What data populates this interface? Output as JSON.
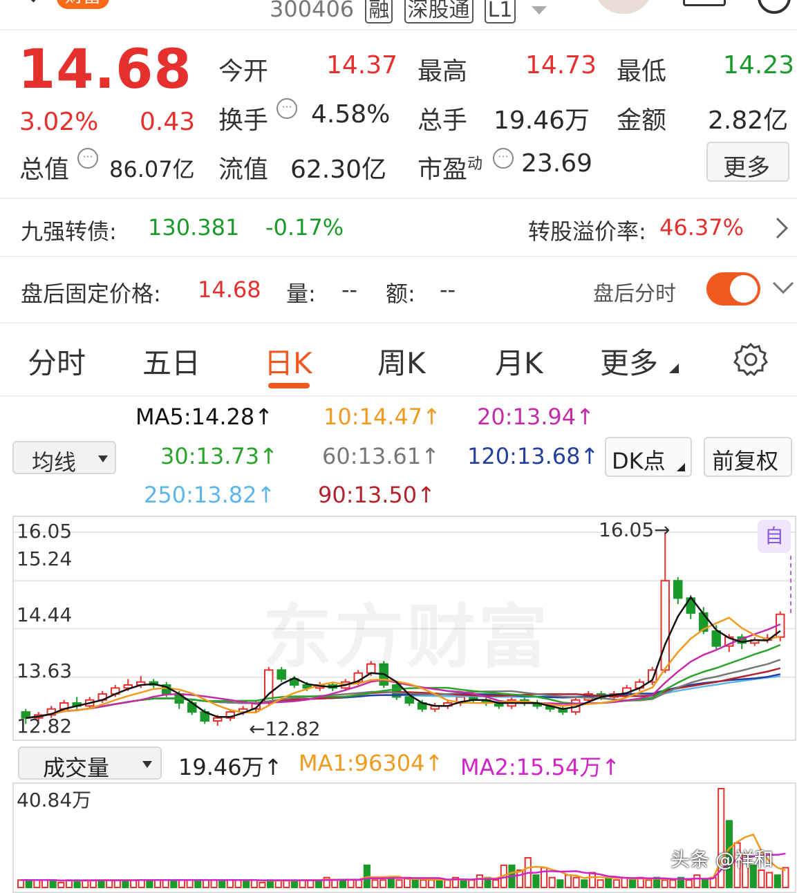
{
  "header": {
    "stock_code": "300406",
    "tags": [
      "融",
      "深股通",
      "L1"
    ],
    "badge": "财富"
  },
  "quote": {
    "price": "14.68",
    "change_pct": "3.02%",
    "change_amt": "0.43",
    "open_label": "今开",
    "open": "14.37",
    "high_label": "最高",
    "high": "14.73",
    "low_label": "最低",
    "low": "14.23",
    "turnover_label": "换手",
    "turnover": "4.58%",
    "volume_label": "总手",
    "volume": "19.46万",
    "amount_label": "金额",
    "amount": "2.82亿",
    "mktcap_label": "总值",
    "mktcap": "86.07亿",
    "float_label": "流值",
    "float": "62.30亿",
    "pe_label": "市盈",
    "pe_sup": "动",
    "pe": "23.69",
    "more_button": "更多"
  },
  "bond": {
    "label": "九强转债:",
    "price": "130.381",
    "change": "-0.17%",
    "premium_label": "转股溢价率:",
    "premium": "46.37%"
  },
  "afterhours": {
    "label": "盘后固定价格:",
    "price": "14.68",
    "vol_label": "量:",
    "vol": "--",
    "amt_label": "额:",
    "amt": "--",
    "toggle_label": "盘后分时",
    "toggle_on": true
  },
  "tabs": [
    "分时",
    "五日",
    "日K",
    "周K",
    "月K",
    "更多"
  ],
  "active_tab": 2,
  "ma": {
    "ma5": "MA5:14.28↑",
    "ma10": "10:14.47↑",
    "ma20": "20:13.94↑",
    "ma30": "30:13.73↑",
    "ma60": "60:13.61↑",
    "ma120": "120:13.68↑",
    "ma250": "250:13.82↑",
    "ma90": "90:13.50↑",
    "select_label": "均线",
    "dk_button": "DK点",
    "adjust_button": "前复权"
  },
  "chart_data": {
    "type": "candlestick",
    "y_ticks": [
      "16.05",
      "15.24",
      "14.44",
      "13.63",
      "12.82"
    ],
    "ylim": [
      12.82,
      16.05
    ],
    "max_label": "16.05→",
    "min_label": "←12.82",
    "auto_label": "自",
    "watermark": "东方财富",
    "candles": [
      [
        13.05,
        12.95,
        13.1,
        12.85
      ],
      [
        12.95,
        13.0,
        13.05,
        12.9
      ],
      [
        13.0,
        13.1,
        13.15,
        12.95
      ],
      [
        13.1,
        13.2,
        13.25,
        13.05
      ],
      [
        13.2,
        13.15,
        13.3,
        13.1
      ],
      [
        13.15,
        13.25,
        13.3,
        13.1
      ],
      [
        13.25,
        13.35,
        13.4,
        13.2
      ],
      [
        13.35,
        13.45,
        13.5,
        13.3
      ],
      [
        13.45,
        13.5,
        13.6,
        13.4
      ],
      [
        13.5,
        13.55,
        13.65,
        13.45
      ],
      [
        13.55,
        13.5,
        13.6,
        13.45
      ],
      [
        13.5,
        13.35,
        13.55,
        13.3
      ],
      [
        13.35,
        13.2,
        13.4,
        13.1
      ],
      [
        13.2,
        13.05,
        13.25,
        13.0
      ],
      [
        13.05,
        12.9,
        13.1,
        12.85
      ],
      [
        12.9,
        12.95,
        13.0,
        12.82
      ],
      [
        12.95,
        13.05,
        13.1,
        12.9
      ],
      [
        13.05,
        13.1,
        13.15,
        13.0
      ],
      [
        13.1,
        13.2,
        13.25,
        13.05
      ],
      [
        13.2,
        13.75,
        13.8,
        13.15
      ],
      [
        13.75,
        13.6,
        13.8,
        13.55
      ],
      [
        13.6,
        13.5,
        13.65,
        13.45
      ],
      [
        13.5,
        13.45,
        13.55,
        13.4
      ],
      [
        13.45,
        13.5,
        13.55,
        13.4
      ],
      [
        13.5,
        13.45,
        13.55,
        13.4
      ],
      [
        13.45,
        13.55,
        13.6,
        13.4
      ],
      [
        13.55,
        13.7,
        13.75,
        13.5
      ],
      [
        13.7,
        13.85,
        13.9,
        13.65
      ],
      [
        13.85,
        13.5,
        13.9,
        13.45
      ],
      [
        13.5,
        13.3,
        13.55,
        13.25
      ],
      [
        13.3,
        13.2,
        13.35,
        13.15
      ],
      [
        13.2,
        13.1,
        13.25,
        13.05
      ],
      [
        13.1,
        13.15,
        13.2,
        13.05
      ],
      [
        13.15,
        13.2,
        13.25,
        13.1
      ],
      [
        13.2,
        13.3,
        13.35,
        13.15
      ],
      [
        13.3,
        13.25,
        13.35,
        13.2
      ],
      [
        13.25,
        13.2,
        13.3,
        13.15
      ],
      [
        13.2,
        13.15,
        13.25,
        13.1
      ],
      [
        13.15,
        13.25,
        13.3,
        13.1
      ],
      [
        13.25,
        13.2,
        13.3,
        13.15
      ],
      [
        13.2,
        13.15,
        13.25,
        13.1
      ],
      [
        13.15,
        13.1,
        13.2,
        13.05
      ],
      [
        13.1,
        13.05,
        13.15,
        13.0
      ],
      [
        13.05,
        13.25,
        13.3,
        13.0
      ],
      [
        13.25,
        13.35,
        13.4,
        13.2
      ],
      [
        13.35,
        13.3,
        13.4,
        13.25
      ],
      [
        13.3,
        13.35,
        13.4,
        13.25
      ],
      [
        13.35,
        13.45,
        13.5,
        13.3
      ],
      [
        13.45,
        13.55,
        13.6,
        13.4
      ],
      [
        13.55,
        13.75,
        13.8,
        13.5
      ],
      [
        13.75,
        15.24,
        16.05,
        13.7
      ],
      [
        15.24,
        14.95,
        15.3,
        14.85
      ],
      [
        14.95,
        14.7,
        15.0,
        14.6
      ],
      [
        14.7,
        14.4,
        14.8,
        14.35
      ],
      [
        14.4,
        14.15,
        14.5,
        14.1
      ],
      [
        14.15,
        14.3,
        14.35,
        14.05
      ],
      [
        14.3,
        14.2,
        14.35,
        14.1
      ],
      [
        14.2,
        14.25,
        14.3,
        14.15
      ],
      [
        14.25,
        14.28,
        14.35,
        14.2
      ],
      [
        14.3,
        14.68,
        14.73,
        14.23
      ]
    ]
  },
  "volume": {
    "select_label": "成交量",
    "current": "19.46万↑",
    "ma1": "MA1:96304↑",
    "ma2": "MA2:15.54万↑",
    "y_max": "40.84万",
    "watermark": "头条 @祥和",
    "bars": [
      3,
      3,
      3,
      3,
      3,
      2,
      3,
      3,
      3,
      3,
      3,
      3,
      3,
      3,
      3,
      3,
      3,
      3,
      3,
      3,
      3,
      3,
      3,
      3,
      3,
      3,
      3,
      3,
      3,
      3,
      2,
      3,
      3,
      3,
      3,
      3,
      3,
      3,
      4,
      3,
      3,
      3,
      3,
      9,
      3,
      3,
      4,
      3,
      4,
      3,
      3,
      3,
      3,
      3,
      4,
      3,
      3,
      5,
      4,
      3,
      9,
      9,
      7,
      12,
      5,
      8,
      4,
      3,
      5,
      4,
      3,
      6,
      3,
      4,
      3,
      4,
      3,
      4,
      3,
      4,
      3,
      3,
      4,
      3,
      5,
      3,
      4,
      40,
      27,
      18,
      13,
      9,
      7,
      6,
      5,
      8
    ]
  }
}
